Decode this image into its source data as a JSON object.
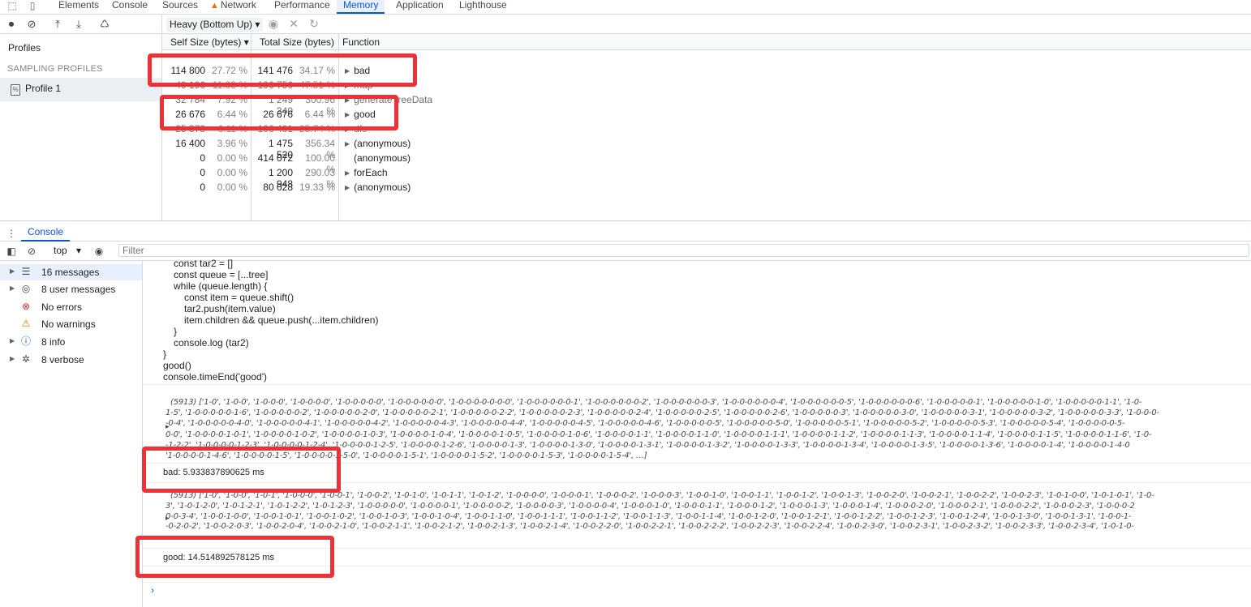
{
  "tabs": [
    "Elements",
    "Console",
    "Sources",
    "Network",
    "Performance",
    "Memory",
    "Application",
    "Lighthouse"
  ],
  "active_tab": "Memory",
  "memory": {
    "profiles_label": "Profiles",
    "sampling_label": "SAMPLING PROFILES",
    "profile_item": "Profile 1",
    "view_select": "Heavy (Bottom Up)",
    "columns": {
      "self_size": "Self Size (bytes)",
      "total_size": "Total Size (bytes)",
      "function": "Function"
    },
    "rows": [
      {
        "self": "114 800",
        "self_pct": "27.72 %",
        "total": "141 476",
        "total_pct": "34.17 %",
        "fn": "bad",
        "arrow": true
      },
      {
        "self": "49 196",
        "self_pct": "11.88 %",
        "total": "196 756",
        "total_pct": "47.51 %",
        "fn": "map",
        "arrow": true
      },
      {
        "self": "32 784",
        "self_pct": "7.92 %",
        "total": "1 249 340",
        "total_pct": "300.96 %",
        "fn": "generateTreeData",
        "arrow": true
      },
      {
        "self": "26 676",
        "self_pct": "6.44 %",
        "total": "26 676",
        "total_pct": "6.44 %",
        "fn": "good",
        "arrow": true
      },
      {
        "self": "25 373",
        "self_pct": "6.11 %",
        "total": "106 401",
        "total_pct": "25.74 %",
        "fn": "dfs",
        "arrow": true
      },
      {
        "self": "16 400",
        "self_pct": "3.96 %",
        "total": "1 475 520",
        "total_pct": "356.34 %",
        "fn": "(anonymous)",
        "arrow": true
      },
      {
        "self": "0",
        "self_pct": "0.00 %",
        "total": "414 072",
        "total_pct": "100.00 %",
        "fn": "(anonymous)",
        "arrow": false
      },
      {
        "self": "0",
        "self_pct": "0.00 %",
        "total": "1 200 948",
        "total_pct": "290.03 %",
        "fn": "forEach",
        "arrow": true
      },
      {
        "self": "0",
        "self_pct": "0.00 %",
        "total": "80 028",
        "total_pct": "19.33 %",
        "fn": "(anonymous)",
        "arrow": true
      }
    ]
  },
  "drawer": {
    "tab": "Console",
    "context": "top",
    "filter_placeholder": "Filter"
  },
  "console_sidebar": [
    {
      "label": "16 messages",
      "icon": "list-icon",
      "arrow": true
    },
    {
      "label": "8 user messages",
      "icon": "user-icon",
      "arrow": true
    },
    {
      "label": "No errors",
      "icon": "error-icon",
      "arrow": false
    },
    {
      "label": "No warnings",
      "icon": "warning-icon",
      "arrow": false
    },
    {
      "label": "8 info",
      "icon": "info-icon",
      "arrow": true
    },
    {
      "label": "8 verbose",
      "icon": "bug-icon",
      "arrow": true
    }
  ],
  "code_lines": [
    "const tar2 = []",
    "const queue = [...tree]",
    "while (queue.length) {",
    "const item = queue.shift()",
    "tar2.push(item.value)",
    "item.children && queue.push(...item.children)",
    "}",
    "console.log (tar2)",
    "}",
    "good()",
    "console.timeEnd('good')"
  ],
  "bad_array_lines": [
    "(5913) ['1-0', '1-0-0', '1-0-0-0', '1-0-0-0-0', '1-0-0-0-0-0', '1-0-0-0-0-0-0', '1-0-0-0-0-0-0-0', '1-0-0-0-0-0-0-1', '1-0-0-0-0-0-0-2', '1-0-0-0-0-0-0-3', '1-0-0-0-0-0-0-4', '1-0-0-0-0-0-0-5', '1-0-0-0-0-0-0-6', '1-0-0-0-0-0-1', '1-0-0-0-0-0-1-0', '1-0-0-0-0-0-1-1', '1-0-",
    "1-5', '1-0-0-0-0-0-1-6', '1-0-0-0-0-0-2', '1-0-0-0-0-0-2-0', '1-0-0-0-0-0-2-1', '1-0-0-0-0-0-2-2', '1-0-0-0-0-0-2-3', '1-0-0-0-0-0-2-4', '1-0-0-0-0-0-2-5', '1-0-0-0-0-0-2-6', '1-0-0-0-0-0-3', '1-0-0-0-0-0-3-0', '1-0-0-0-0-0-3-1', '1-0-0-0-0-0-3-2', '1-0-0-0-0-0-3-3', '1-0-0-0-",
    "-0-4', '1-0-0-0-0-0-4-0', '1-0-0-0-0-0-4-1', '1-0-0-0-0-0-4-2', '1-0-0-0-0-0-4-3', '1-0-0-0-0-0-4-4', '1-0-0-0-0-0-4-5', '1-0-0-0-0-0-4-6', '1-0-0-0-0-0-5', '1-0-0-0-0-0-5-0', '1-0-0-0-0-0-5-1', '1-0-0-0-0-0-5-2', '1-0-0-0-0-0-5-3', '1-0-0-0-0-0-5-4', '1-0-0-0-0-0-5-",
    "0-0', '1-0-0-0-0-1-0-1', '1-0-0-0-0-1-0-2', '1-0-0-0-0-1-0-3', '1-0-0-0-0-1-0-4', '1-0-0-0-0-1-0-5', '1-0-0-0-0-1-0-6', '1-0-0-0-0-1-1', '1-0-0-0-0-1-1-0', '1-0-0-0-0-1-1-1', '1-0-0-0-0-1-1-2', '1-0-0-0-0-1-1-3', '1-0-0-0-0-1-1-4', '1-0-0-0-0-1-1-5', '1-0-0-0-0-1-1-6', '1-0-",
    "-1-2-2', '1-0-0-0-0-1-2-3', '1-0-0-0-0-1-2-4', '1-0-0-0-0-1-2-5', '1-0-0-0-0-1-2-6', '1-0-0-0-0-1-3', '1-0-0-0-0-1-3-0', '1-0-0-0-0-1-3-1', '1-0-0-0-0-1-3-2', '1-0-0-0-0-1-3-3', '1-0-0-0-0-1-3-4', '1-0-0-0-0-1-3-5', '1-0-0-0-0-1-3-6', '1-0-0-0-0-1-4', '1-0-0-0-0-1-4-0",
    "'1-0-0-0-0-1-4-6', '1-0-0-0-0-1-5', '1-0-0-0-0-1-5-0', '1-0-0-0-0-1-5-1', '1-0-0-0-0-1-5-2', '1-0-0-0-0-1-5-3', '1-0-0-0-0-1-5-4', …]"
  ],
  "bad_timing": "bad: 5.933837890625 ms",
  "good_array_lines": [
    "(5913) ['1-0', '1-0-0', '1-0-1', '1-0-0-0', '1-0-0-1', '1-0-0-2', '1-0-1-0', '1-0-1-1', '1-0-1-2', '1-0-0-0-0', '1-0-0-0-1', '1-0-0-0-2', '1-0-0-0-3', '1-0-0-1-0', '1-0-0-1-1', '1-0-0-1-2', '1-0-0-1-3', '1-0-0-2-0', '1-0-0-2-1', '1-0-0-2-2', '1-0-0-2-3', '1-0-1-0-0', '1-0-1-0-1', '1-0-",
    "3', '1-0-1-2-0', '1-0-1-2-1', '1-0-1-2-2', '1-0-1-2-3', '1-0-0-0-0-0', '1-0-0-0-0-1', '1-0-0-0-0-2', '1-0-0-0-0-3', '1-0-0-0-0-4', '1-0-0-0-1-0', '1-0-0-0-1-1', '1-0-0-0-1-2', '1-0-0-0-1-3', '1-0-0-0-1-4', '1-0-0-0-2-0', '1-0-0-0-2-1', '1-0-0-0-2-2', '1-0-0-0-2-3', '1-0-0-0-2",
    "0-0-3-4', '1-0-0-1-0-0', '1-0-0-1-0-1', '1-0-0-1-0-2', '1-0-0-1-0-3', '1-0-0-1-0-4', '1-0-0-1-1-0', '1-0-0-1-1-1', '1-0-0-1-1-2', '1-0-0-1-1-3', '1-0-0-1-1-4', '1-0-0-1-2-0', '1-0-0-1-2-1', '1-0-0-1-2-2', '1-0-0-1-2-3', '1-0-0-1-2-4', '1-0-0-1-3-0', '1-0-0-1-3-1', '1-0-0-1-",
    "-0-2-0-2', '1-0-0-2-0-3', '1-0-0-2-0-4', '1-0-0-2-1-0', '1-0-0-2-1-1', '1-0-0-2-1-2', '1-0-0-2-1-3', '1-0-0-2-1-4', '1-0-0-2-2-0', '1-0-0-2-2-1', '1-0-0-2-2-2', '1-0-0-2-2-3', '1-0-0-2-2-4', '1-0-0-2-3-0', '1-0-0-2-3-1', '1-0-0-2-3-2', '1-0-0-2-3-3', '1-0-0-2-3-4', '1-0-1-0-"
  ],
  "good_timing": "good: 14.514892578125 ms"
}
